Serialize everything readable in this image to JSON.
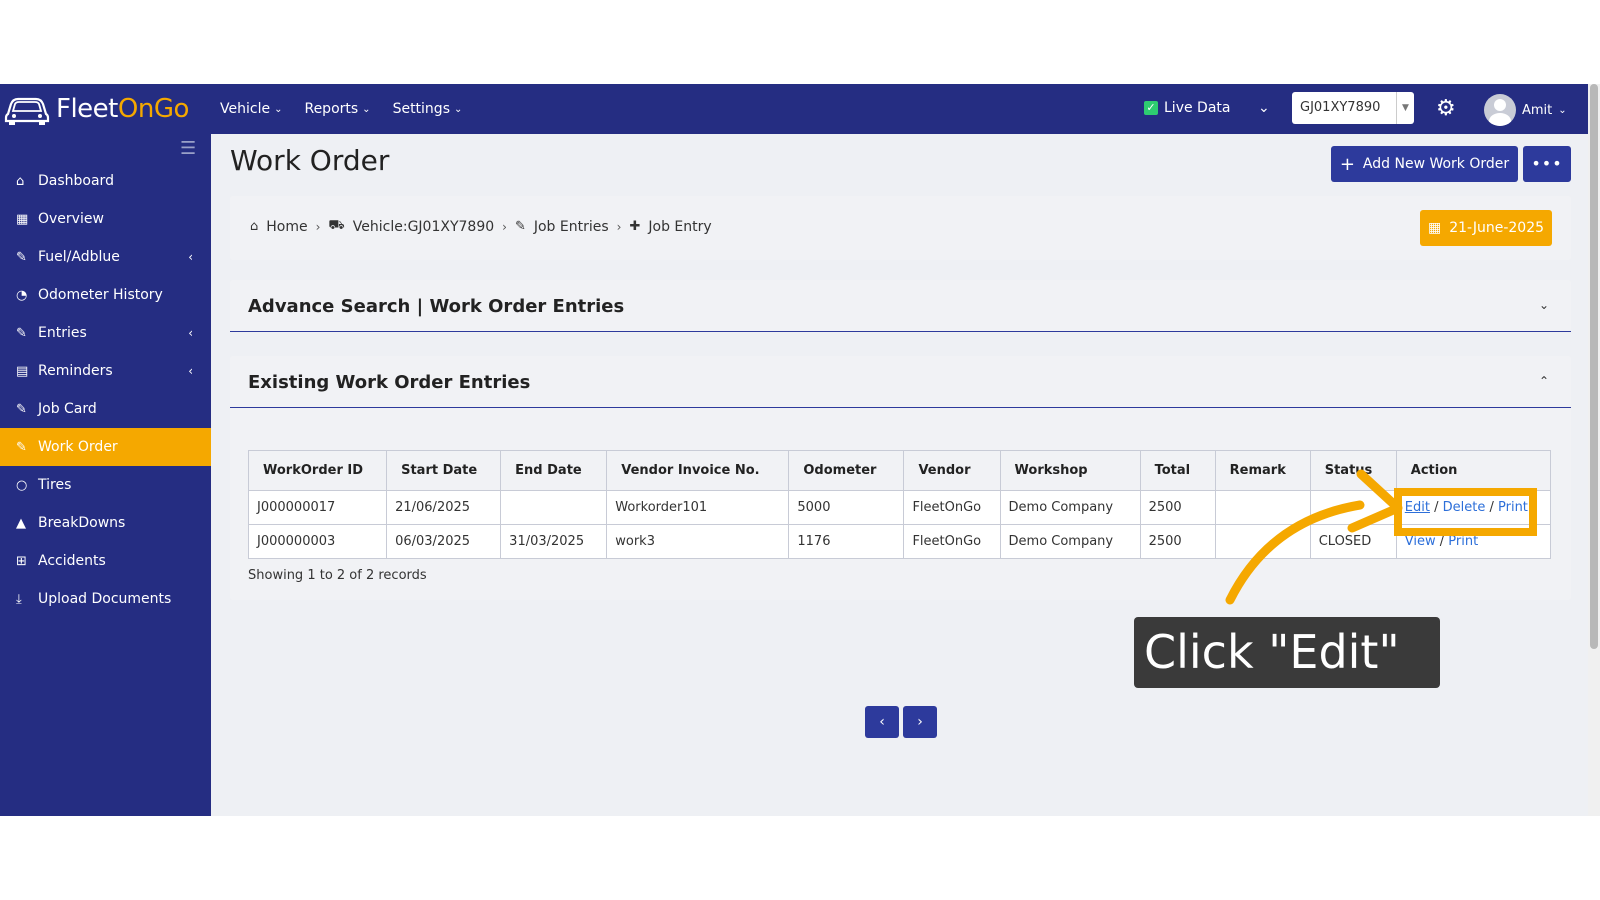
{
  "brand": {
    "part1": "Fleet",
    "part2": "OnGo"
  },
  "topnav": [
    {
      "label": "Vehicle"
    },
    {
      "label": "Reports"
    },
    {
      "label": "Settings"
    }
  ],
  "live": {
    "label": "Live Data"
  },
  "vehicle_select": {
    "value": "GJ01XY7890"
  },
  "user": {
    "name": "Amit"
  },
  "sidebar": [
    {
      "label": "Dashboard",
      "icon": "home-icon",
      "glyph": "⌂"
    },
    {
      "label": "Overview",
      "icon": "grid-icon",
      "glyph": "▦"
    },
    {
      "label": "Fuel/Adblue",
      "icon": "edit-icon",
      "glyph": "✎",
      "caret": "‹"
    },
    {
      "label": "Odometer History",
      "icon": "gauge-icon",
      "glyph": "◔"
    },
    {
      "label": "Entries",
      "icon": "edit-icon",
      "glyph": "✎",
      "caret": "‹"
    },
    {
      "label": "Reminders",
      "icon": "calendar-icon",
      "glyph": "▤",
      "caret": "‹"
    },
    {
      "label": "Job Card",
      "icon": "edit-icon",
      "glyph": "✎"
    },
    {
      "label": "Work Order",
      "icon": "edit-icon",
      "glyph": "✎",
      "active": true
    },
    {
      "label": "Tires",
      "icon": "circle-icon",
      "glyph": "○"
    },
    {
      "label": "BreakDowns",
      "icon": "warning-icon",
      "glyph": "▲"
    },
    {
      "label": "Accidents",
      "icon": "plus-square-icon",
      "glyph": "⊞"
    },
    {
      "label": "Upload Documents",
      "icon": "download-icon",
      "glyph": "⤓"
    }
  ],
  "page": {
    "title": "Work Order",
    "add_button": "Add New Work Order",
    "more_button": "•••"
  },
  "breadcrumb": [
    {
      "label": "Home"
    },
    {
      "label": "Vehicle:GJ01XY7890"
    },
    {
      "label": "Job Entries"
    },
    {
      "label": "Job Entry"
    }
  ],
  "date_button": "21-June-2025",
  "search_card": {
    "title": "Advance Search | Work Order Entries"
  },
  "entries_card": {
    "title": "Existing Work Order Entries"
  },
  "table": {
    "headers": [
      "WorkOrder ID",
      "Start Date",
      "End Date",
      "Vendor Invoice No.",
      "Odometer",
      "Vendor",
      "Workshop",
      "Total",
      "Remark",
      "Status",
      "Action"
    ],
    "rows": [
      {
        "id": "J000000017",
        "start": "21/06/2025",
        "end": "",
        "invoice": "Workorder101",
        "odometer": "5000",
        "vendor": "FleetOnGo",
        "workshop": "Demo Company",
        "total": "2500",
        "remark": "",
        "status": "",
        "actions": [
          "Edit",
          "Delete",
          "Print"
        ]
      },
      {
        "id": "J000000003",
        "start": "06/03/2025",
        "end": "31/03/2025",
        "invoice": "work3",
        "odometer": "1176",
        "vendor": "FleetOnGo",
        "workshop": "Demo Company",
        "total": "2500",
        "remark": "",
        "status": "CLOSED",
        "actions": [
          "View",
          "Print"
        ]
      }
    ],
    "summary": "Showing 1 to 2 of 2 records"
  },
  "pager": {
    "prev": "‹",
    "next": "›"
  },
  "callout": {
    "text": "Click \"Edit\""
  },
  "colors": {
    "navy": "#252d82",
    "accent": "#f5a800",
    "button": "#2d3a9c"
  }
}
